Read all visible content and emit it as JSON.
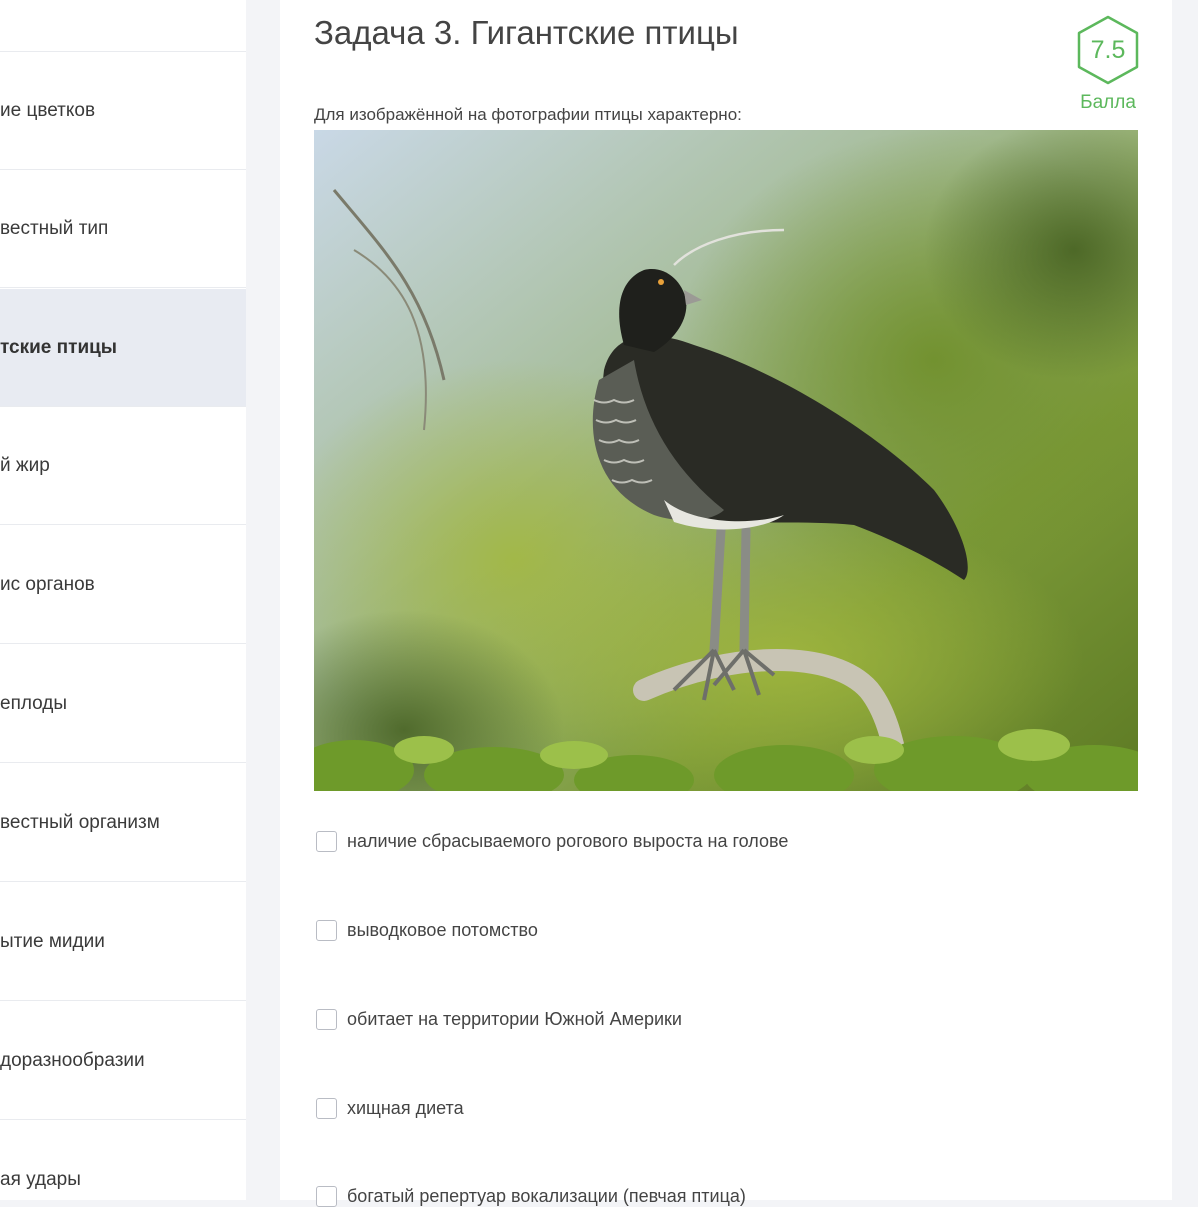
{
  "sidebar": {
    "items": [
      {
        "label": "ие цветков",
        "active": false
      },
      {
        "label": "вестный тип",
        "active": false
      },
      {
        "label": "тские птицы",
        "active": true
      },
      {
        "label": "й жир",
        "active": false
      },
      {
        "label": "ис органов",
        "active": false
      },
      {
        "label": "еплоды",
        "active": false
      },
      {
        "label": "вестный организм",
        "active": false
      },
      {
        "label": "ытие мидии",
        "active": false
      },
      {
        "label": "доразнообразии",
        "active": false
      },
      {
        "label": "ая удары",
        "active": false
      }
    ]
  },
  "task": {
    "title": "Задача 3. Гигантские птицы",
    "score": {
      "value": "7.5",
      "label": "Балла"
    },
    "prompt": "Для изображённой на фотографии птицы характерно:",
    "options": [
      {
        "label": "наличие сбрасываемого рогового выроста на голове",
        "checked": false
      },
      {
        "label": "выводковое потомство",
        "checked": false
      },
      {
        "label": "обитает на территории Южной Америки",
        "checked": false
      },
      {
        "label": "хищная диета",
        "checked": false
      },
      {
        "label": "богатый репертуар вокализации (певчая птица)",
        "checked": false
      }
    ]
  },
  "colors": {
    "accent": "#5cb85c",
    "active_bg": "#e8ebf2",
    "page_bg": "#f3f4f7"
  }
}
